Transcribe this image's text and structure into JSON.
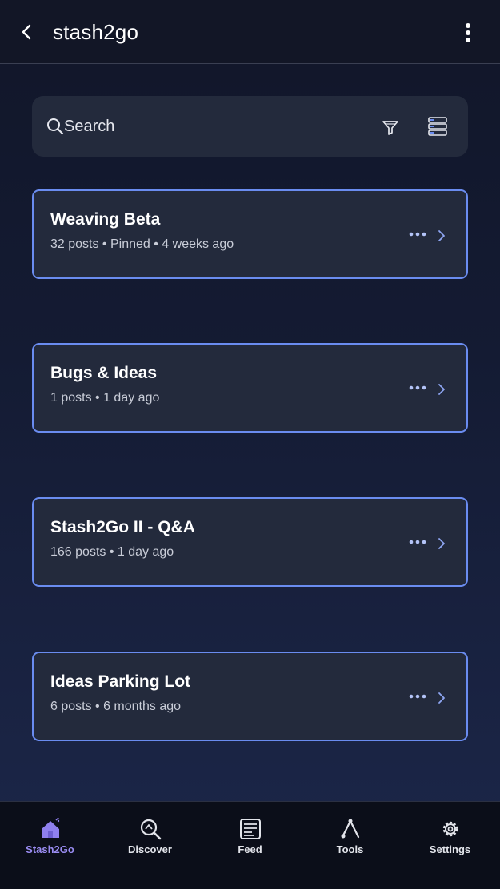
{
  "header": {
    "title": "stash2go",
    "back_icon": "chevron-left-icon",
    "more_icon": "vertical-ellipsis-icon"
  },
  "search": {
    "placeholder": "Search",
    "value": "",
    "filter_icon": "filter-icon",
    "view_icon": "list-view-icon"
  },
  "boards": [
    {
      "title": "Weaving Beta",
      "meta": "32 posts • Pinned • 4 weeks ago"
    },
    {
      "title": "Bugs & Ideas",
      "meta": "1 posts • 1 day ago"
    },
    {
      "title": "Stash2Go II - Q&A",
      "meta": "166 posts • 1 day ago"
    },
    {
      "title": "Ideas Parking Lot",
      "meta": "6 posts • 6 months ago"
    }
  ],
  "tabbar": {
    "items": [
      {
        "label": "Stash2Go",
        "icon": "home-icon",
        "active": true
      },
      {
        "label": "Discover",
        "icon": "discover-icon",
        "active": false
      },
      {
        "label": "Feed",
        "icon": "feed-icon",
        "active": false
      },
      {
        "label": "Tools",
        "icon": "tools-icon",
        "active": false
      },
      {
        "label": "Settings",
        "icon": "gear-icon",
        "active": false
      }
    ]
  },
  "colors": {
    "accent": "#6a8cf0",
    "active_tab": "#9a8cf2",
    "card_bg": "#232a3c",
    "background": "#141b33"
  }
}
